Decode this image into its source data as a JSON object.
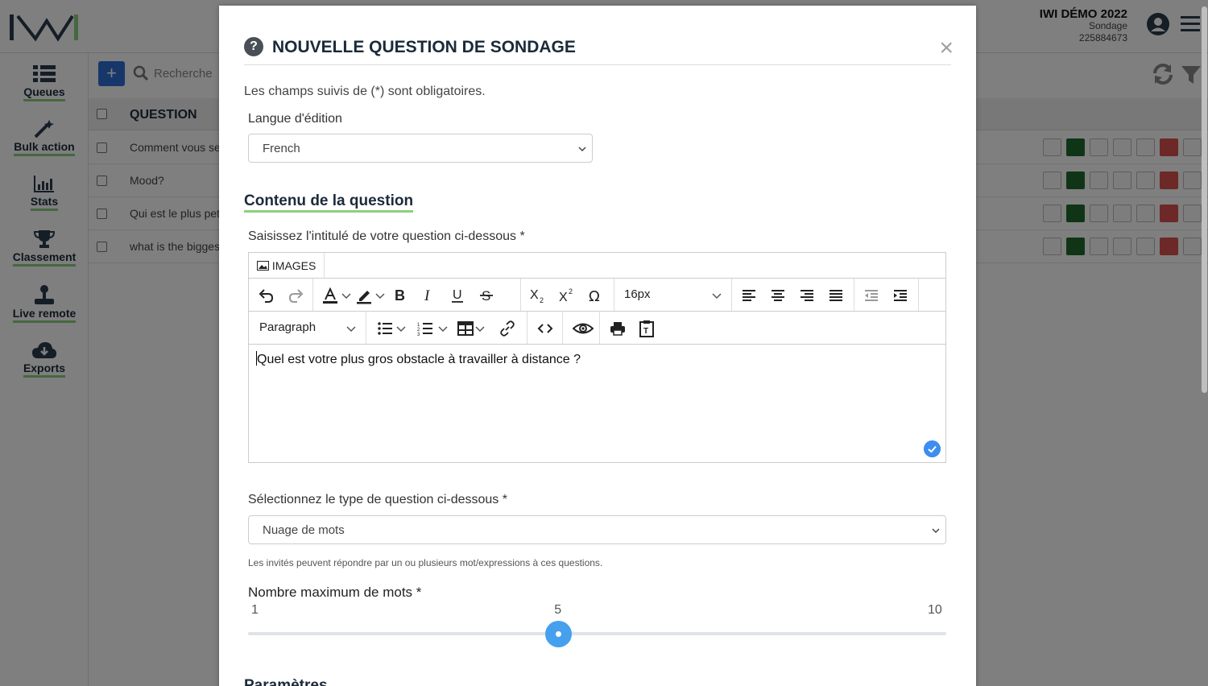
{
  "app": {
    "account_name": "IWI DÉMO 2022",
    "account_type": "Sondage",
    "account_id": "225884673"
  },
  "sidebar": {
    "items": [
      {
        "label": "Queues",
        "icon": "list-icon"
      },
      {
        "label": "Bulk action",
        "icon": "magic-wand-icon"
      },
      {
        "label": "Stats",
        "icon": "bar-chart-icon"
      },
      {
        "label": "Classement",
        "icon": "trophy-icon"
      },
      {
        "label": "Live remote",
        "icon": "joystick-icon"
      },
      {
        "label": "Exports",
        "icon": "cloud-download-icon"
      }
    ]
  },
  "list": {
    "search_placeholder": "Recherche",
    "column_header": "QUESTION",
    "rows": [
      {
        "question": "Comment vous se"
      },
      {
        "question": "Mood?"
      },
      {
        "question": "Qui est le plus pet"
      },
      {
        "question": "what is the bigges"
      }
    ]
  },
  "modal": {
    "title": "NOUVELLE QUESTION DE SONDAGE",
    "required_note": "Les champs suivis de (*) sont obligatoires.",
    "language_label": "Langue d'édition",
    "language_value": "French",
    "section_content": "Contenu de la question",
    "question_label": "Saisissez l'intitulé de votre question ci-dessous *",
    "editor": {
      "images_button": "IMAGES",
      "font_size": "16px",
      "block_format": "Paragraph",
      "content": "Quel est votre plus gros obstacle à travailler à distance ?"
    },
    "type_label": "Sélectionnez le type de question ci-dessous *",
    "type_value": "Nuage de mots",
    "type_hint": "Les invités peuvent répondre par un ou plusieurs mot/expressions à ces questions.",
    "max_words_label": "Nombre maximum de mots *",
    "slider": {
      "min": "1",
      "value": "5",
      "max": "10",
      "fraction": 0.4444
    },
    "section_params": "Paramètres"
  },
  "colors": {
    "primary_blue": "#2f6fd6",
    "accent_green": "#8bd17c",
    "slider_blue": "#46a0ee",
    "danger_red": "#d9534f",
    "play_green": "#1f6b2c"
  }
}
